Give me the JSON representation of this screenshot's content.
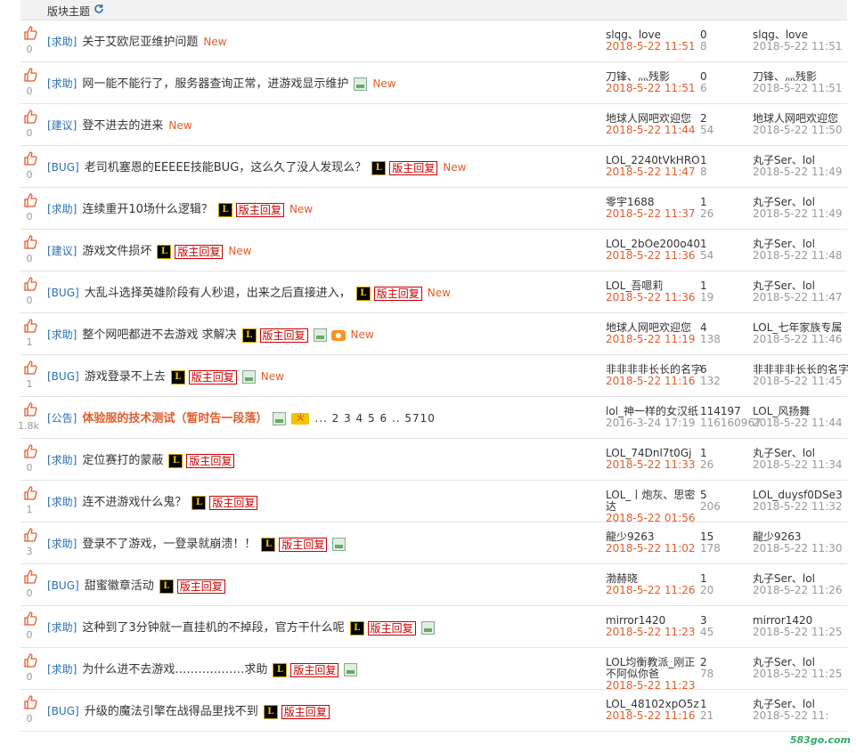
{
  "header": {
    "title": "版块主题",
    "refresh_icon": "refresh-icon"
  },
  "colors": {
    "tag": "#2a6fb0",
    "new": "#e25c2a",
    "date": "#e25c2a",
    "badge": "#cc0000",
    "notice": "#e25c2a"
  },
  "rows": [
    {
      "likes": "0",
      "tag": "[求助]",
      "title": "关于艾欧尼亚维护问题",
      "l": false,
      "badge": "",
      "img": false,
      "cam": false,
      "new": "New",
      "author": "slqg、love",
      "date": "2018-5-22 11:51",
      "replies": "0",
      "views": "8",
      "last_user": "slqg、love",
      "last_date": "2018-5-22 11:51"
    },
    {
      "likes": "0",
      "tag": "[求助]",
      "title": "网一能不能行了，服务器查询正常，进游戏显示维护",
      "l": false,
      "badge": "",
      "img": true,
      "cam": false,
      "new": "New",
      "author": "刀锋、灬残影",
      "date": "2018-5-22 11:51",
      "replies": "0",
      "views": "6",
      "last_user": "刀锋、灬残影",
      "last_date": "2018-5-22 11:51"
    },
    {
      "likes": "0",
      "tag": "[建议]",
      "title": "登不进去的进来",
      "l": false,
      "badge": "",
      "img": false,
      "cam": false,
      "new": "New",
      "author": "地球人网吧欢迎您",
      "date": "2018-5-22 11:44",
      "replies": "2",
      "views": "54",
      "last_user": "地球人网吧欢迎您",
      "last_date": "2018-5-22 11:50"
    },
    {
      "likes": "0",
      "tag": "[BUG]",
      "title": "老司机塞恩的EEEEE技能BUG，这么久了没人发现么？",
      "l": true,
      "badge": "版主回复",
      "img": false,
      "cam": false,
      "new": "New",
      "author": "LOL_2240tVkHRO",
      "date": "2018-5-22 11:47",
      "replies": "1",
      "views": "8",
      "last_user": "丸子Ser、lol",
      "last_date": "2018-5-22 11:49"
    },
    {
      "likes": "0",
      "tag": "[求助]",
      "title": "连续重开10场什么逻辑？",
      "l": true,
      "badge": "版主回复",
      "img": false,
      "cam": false,
      "new": "New",
      "author": "零宇1688",
      "date": "2018-5-22 11:37",
      "replies": "1",
      "views": "26",
      "last_user": "丸子Ser、lol",
      "last_date": "2018-5-22 11:49"
    },
    {
      "likes": "0",
      "tag": "[建议]",
      "title": "游戏文件损坏",
      "l": true,
      "badge": "版主回复",
      "img": false,
      "cam": false,
      "new": "New",
      "author": "LOL_2bOe200o40",
      "date": "2018-5-22 11:36",
      "replies": "1",
      "views": "54",
      "last_user": "丸子Ser、lol",
      "last_date": "2018-5-22 11:48"
    },
    {
      "likes": "0",
      "tag": "[BUG]",
      "title": "大乱斗选择英雄阶段有人秒退，出来之后直接进入，",
      "l": true,
      "badge": "版主回复",
      "img": false,
      "cam": false,
      "new": "New",
      "author": "LOL_吾嗯莉",
      "date": "2018-5-22 11:36",
      "replies": "1",
      "views": "19",
      "last_user": "丸子Ser、lol",
      "last_date": "2018-5-22 11:47"
    },
    {
      "likes": "1",
      "tag": "[求助]",
      "title": "整个网吧都进不去游戏 求解决",
      "l": true,
      "badge": "版主回复",
      "img": true,
      "cam": true,
      "new": "New",
      "author": "地球人网吧欢迎您",
      "date": "2018-5-22 11:19",
      "replies": "4",
      "views": "138",
      "last_user": "LOL_七年家族专属",
      "last_date": "2018-5-22 11:46"
    },
    {
      "likes": "1",
      "tag": "[BUG]",
      "title": "游戏登录不上去",
      "l": true,
      "badge": "版主回复",
      "img": true,
      "cam": false,
      "new": "New",
      "author": "非非非非长长的名字",
      "date": "2018-5-22 11:16",
      "replies": "6",
      "views": "132",
      "last_user": "非非非非长长的名字",
      "last_date": "2018-5-22 11:45"
    },
    {
      "likes": "1.8k",
      "tag": "[公告]",
      "title": "体验服的技术测试（暂时告一段落）",
      "notice": true,
      "l": false,
      "badge": "",
      "img": true,
      "cam": false,
      "hot": "火",
      "pages": "... 2  3  4  5  6 .. 5710",
      "new": "",
      "author": "lol_神一样的女汉纸",
      "date": "2016-3-24 17:19",
      "replies": "114197",
      "views": "116160967",
      "last_user": "LOL_风扬舞",
      "last_date": "2018-5-22 11:44"
    },
    {
      "likes": "0",
      "tag": "[求助]",
      "title": "定位赛打的蒙蔽",
      "l": true,
      "badge": "版主回复",
      "img": false,
      "cam": false,
      "new": "",
      "author": "LOL_74Dnl7t0Gj",
      "date": "2018-5-22 11:33",
      "replies": "1",
      "views": "26",
      "last_user": "丸子Ser、lol",
      "last_date": "2018-5-22 11:34"
    },
    {
      "likes": "1",
      "tag": "[求助]",
      "title": "连不进游戏什么鬼？",
      "l": true,
      "badge": "版主回复",
      "img": false,
      "cam": false,
      "new": "",
      "author": "LOL_丨炮灰、思密达",
      "date": "2018-5-22 01:56",
      "replies": "5",
      "views": "206",
      "last_user": "LOL_duysf0DSe3",
      "last_date": "2018-5-22 11:32"
    },
    {
      "likes": "3",
      "tag": "[求助]",
      "title": "登录不了游戏，一登录就崩溃！！",
      "l": true,
      "badge": "版主回复",
      "img": true,
      "cam": false,
      "new": "",
      "author": "龍少9263",
      "date": "2018-5-22 11:02",
      "replies": "15",
      "views": "178",
      "last_user": "龍少9263",
      "last_date": "2018-5-22 11:30"
    },
    {
      "likes": "0",
      "tag": "[BUG]",
      "title": "甜蜜徽章活动",
      "l": true,
      "badge": "版主回复",
      "img": false,
      "cam": false,
      "new": "",
      "author": "渤赫晓",
      "date": "2018-5-22 11:26",
      "replies": "1",
      "views": "20",
      "last_user": "丸子Ser、lol",
      "last_date": "2018-5-22 11:26"
    },
    {
      "likes": "0",
      "tag": "[求助]",
      "title": "这种到了3分钟就一直挂机的不掉段，官方干什么呢",
      "l": true,
      "badge": "版主回复",
      "img": true,
      "cam": false,
      "new": "",
      "author": "mirror1420",
      "date": "2018-5-22 11:23",
      "replies": "3",
      "views": "45",
      "last_user": "mirror1420",
      "last_date": "2018-5-22 11:25"
    },
    {
      "likes": "0",
      "tag": "[求助]",
      "title": "为什么进不去游戏………………求助",
      "l": true,
      "badge": "版主回复",
      "img": true,
      "cam": false,
      "new": "",
      "author": "LOL均衡教派_刚正不阿似你爸",
      "date": "2018-5-22 11:23",
      "replies": "2",
      "views": "78",
      "last_user": "丸子Ser、lol",
      "last_date": "2018-5-22 11:25"
    },
    {
      "likes": "0",
      "tag": "[BUG]",
      "title": "升级的魔法引擎在战得品里找不到",
      "l": true,
      "badge": "版主回复",
      "img": false,
      "cam": false,
      "new": "",
      "author": "LOL_48102xpO5z",
      "date": "2018-5-22 11:16",
      "replies": "1",
      "views": "21",
      "last_user": "丸子Ser、lol",
      "last_date": "2018-5-22 11:"
    }
  ],
  "watermark": "583go.com"
}
